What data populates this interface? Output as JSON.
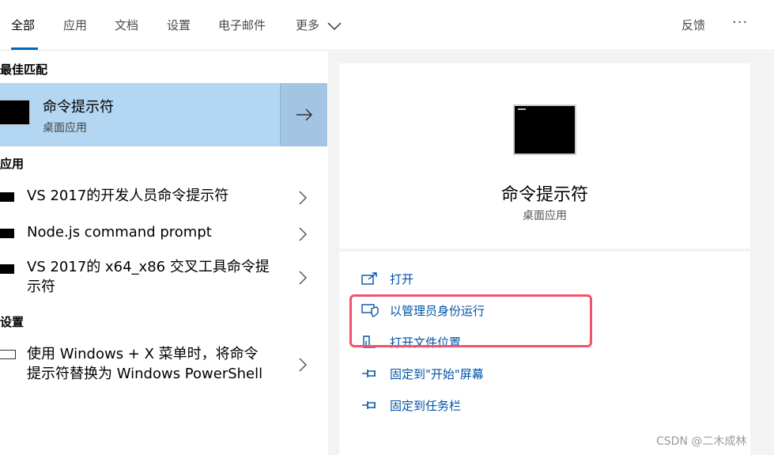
{
  "tabs": [
    {
      "label": "全部",
      "active": true
    },
    {
      "label": "应用"
    },
    {
      "label": "文档"
    },
    {
      "label": "设置"
    },
    {
      "label": "电子邮件"
    },
    {
      "label": "更多"
    }
  ],
  "header_right": {
    "feedback_label": "反馈",
    "more_options": "···"
  },
  "left": {
    "best_match_title": "最佳匹配",
    "best_match": {
      "name": "命令提示符",
      "type": "桌面应用"
    },
    "apps_title": "应用",
    "apps": [
      {
        "lines": [
          "VS 2017的开发人员命令提示符"
        ]
      },
      {
        "lines": [
          "Node.js command prompt"
        ]
      },
      {
        "lines": [
          "VS 2017的 x64_x86 交叉工具命令提",
          "示符"
        ]
      }
    ],
    "settings_title": "设置",
    "settings": [
      {
        "lines": [
          "使用 Windows + X 菜单时，将命令",
          "提示符替换为 Windows PowerShell"
        ]
      }
    ]
  },
  "right": {
    "app_name": "命令提示符",
    "app_type": "桌面应用",
    "actions": [
      {
        "label": "打开",
        "icon": "open-icon"
      },
      {
        "label": "以管理员身份运行",
        "icon": "shield-icon"
      },
      {
        "label": "打开文件位置",
        "icon": "file-location-icon"
      },
      {
        "label": "固定到\"开始\"屏幕",
        "icon": "pin-icon"
      },
      {
        "label": "固定到任务栏",
        "icon": "pin-icon"
      }
    ]
  },
  "watermark": "CSDN @二木成林",
  "colors": {
    "accent": "#0067c0",
    "selection": "#b3d7f3",
    "highlight_border": "#f2536b",
    "link": "#0053a6"
  }
}
